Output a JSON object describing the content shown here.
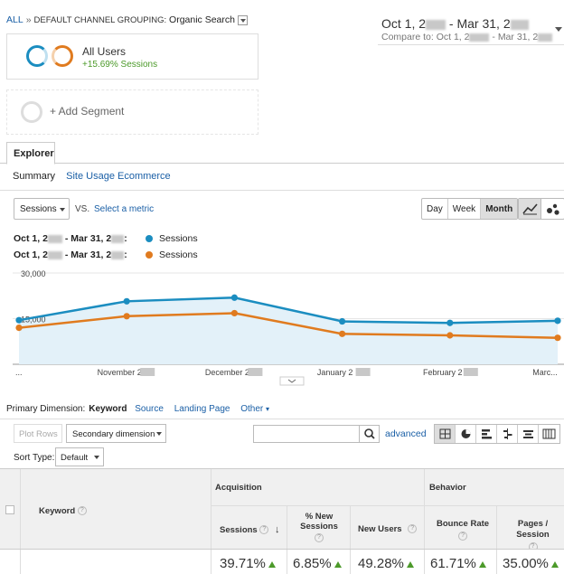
{
  "breadcrumb": {
    "root": "ALL",
    "separator": "»",
    "dimension": "DEFAULT CHANNEL GROUPING:",
    "value": "Organic Search"
  },
  "date_range": {
    "start_prefix": "Oct 1, 2",
    "dash": "-",
    "end_prefix": "Mar 31, 2",
    "compare_label": "Compare to:",
    "compare_start_prefix": "Oct 1, 2",
    "compare_end_prefix": "Mar 31, 2"
  },
  "segment": {
    "name": "All Users",
    "change": "+15.69% Sessions",
    "colors": {
      "primary": "#1b8dc0",
      "compare": "#e07b1f"
    }
  },
  "add_segment": "+ Add Segment",
  "tabs": {
    "explorer": "Explorer",
    "subtabs": [
      "Summary",
      "Site Usage",
      "Ecommerce"
    ]
  },
  "metric": {
    "selected": "Sessions",
    "vs": "VS.",
    "select_metric": "Select a metric"
  },
  "granularity": [
    "Day",
    "Week",
    "Month"
  ],
  "granularity_active": "Month",
  "legend": [
    {
      "range_start": "Oct 1, 2",
      "range_end": "Mar 31, 2",
      "colon": ":",
      "series": "Sessions",
      "color": "#1b8dc0"
    },
    {
      "range_start": "Oct 1, 2",
      "range_end": "Mar 31, 2",
      "colon": ":",
      "series": "Sessions",
      "color": "#e07b1f"
    }
  ],
  "chart_data": {
    "type": "line",
    "x": [
      "...",
      "November 2",
      "December 2",
      "January 2",
      "February 2",
      "Marc..."
    ],
    "ylim": [
      0,
      30000
    ],
    "yticks": [
      "30,000",
      "15,000"
    ],
    "series": [
      {
        "name": "Sessions",
        "color": "#1b8dc0",
        "values": [
          14500,
          20700,
          21900,
          14100,
          13600,
          14300
        ]
      },
      {
        "name": "Sessions",
        "color": "#e07b1f",
        "values": [
          12000,
          15800,
          16800,
          10000,
          9500,
          8700
        ]
      }
    ],
    "grid": true,
    "area_fill": "#e3f1f9"
  },
  "primary_dimension": {
    "label": "Primary Dimension:",
    "active": "Keyword",
    "options": [
      "Source",
      "Landing Page",
      "Other"
    ]
  },
  "table_controls": {
    "plot_rows": "Plot Rows",
    "secondary_dimension": "Secondary dimension",
    "advanced": "advanced",
    "sort_type_label": "Sort Type:",
    "sort_type": "Default"
  },
  "table": {
    "keyword_header": "Keyword",
    "acquisition": "Acquisition",
    "behavior": "Behavior",
    "columns": [
      "Sessions",
      "% New Sessions",
      "New Users",
      "Bounce Rate",
      "Pages / Session"
    ],
    "totals": [
      "39.71%",
      "6.85%",
      "49.28%",
      "61.71%",
      "35.00%"
    ],
    "help": "?",
    "sort_arrow": "↓"
  }
}
